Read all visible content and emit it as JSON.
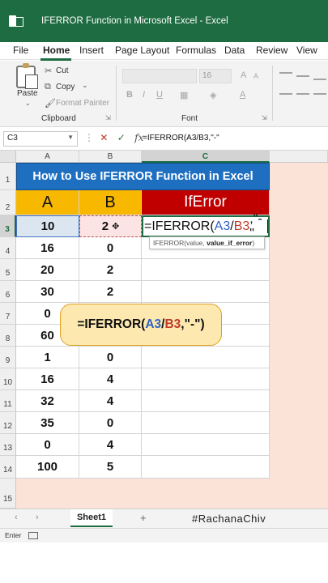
{
  "window": {
    "title": "IFERROR Function in Microsoft Excel  -  Excel"
  },
  "menu": [
    "File",
    "Home",
    "Insert",
    "Page Layout",
    "Formulas",
    "Data",
    "Review",
    "View"
  ],
  "ribbon": {
    "paste_label": "Paste",
    "cut_label": "Cut",
    "copy_label": "Copy",
    "format_painter_label": "Format Painter",
    "clipboard_group": "Clipboard",
    "font_group": "Font",
    "font_size": "16"
  },
  "formula_bar": {
    "name_box": "C3",
    "formula": "=IFERROR(A3/B3,\"-\""
  },
  "columns": [
    "A",
    "B",
    "C"
  ],
  "rows": [
    "1",
    "2",
    "3",
    "4",
    "5",
    "6",
    "7",
    "8",
    "9",
    "10",
    "11",
    "12",
    "13",
    "14",
    "15"
  ],
  "sheet": {
    "banner": "How to Use IFERROR Function in Excel",
    "header_a": "A",
    "header_b": "B",
    "header_c": "IfError",
    "c3_prefix": "=IFERROR(",
    "c3_ref_a": "A3",
    "c3_slash": "/",
    "c3_ref_b": "B3",
    "c3_suffix": ",\"-\"",
    "data": [
      {
        "a": "10",
        "b": "2"
      },
      {
        "a": "16",
        "b": "0"
      },
      {
        "a": "20",
        "b": "2"
      },
      {
        "a": "30",
        "b": "2"
      },
      {
        "a": "0",
        "b": ""
      },
      {
        "a": "60",
        "b": ""
      },
      {
        "a": "1",
        "b": "0"
      },
      {
        "a": "16",
        "b": "4"
      },
      {
        "a": "32",
        "b": "4"
      },
      {
        "a": "35",
        "b": "0"
      },
      {
        "a": "0",
        "b": "4"
      },
      {
        "a": "100",
        "b": "5"
      }
    ]
  },
  "tooltip": {
    "prefix": "IFERROR(value, ",
    "bold": "value_if_error",
    "suffix": ")"
  },
  "callout": {
    "prefix": "=IFERROR(",
    "ref_a": "A3",
    "slash": "/",
    "ref_b": "B3",
    "suffix": ",\"-\")"
  },
  "tabs": {
    "sheet1": "Sheet1",
    "handle": "#RachanaChiv"
  },
  "status": {
    "mode": "Enter"
  },
  "colors": {
    "excel_green": "#1e6c41",
    "banner_blue": "#1f6fc1",
    "header_gold": "#f9b800",
    "iferror_red": "#c00000"
  }
}
